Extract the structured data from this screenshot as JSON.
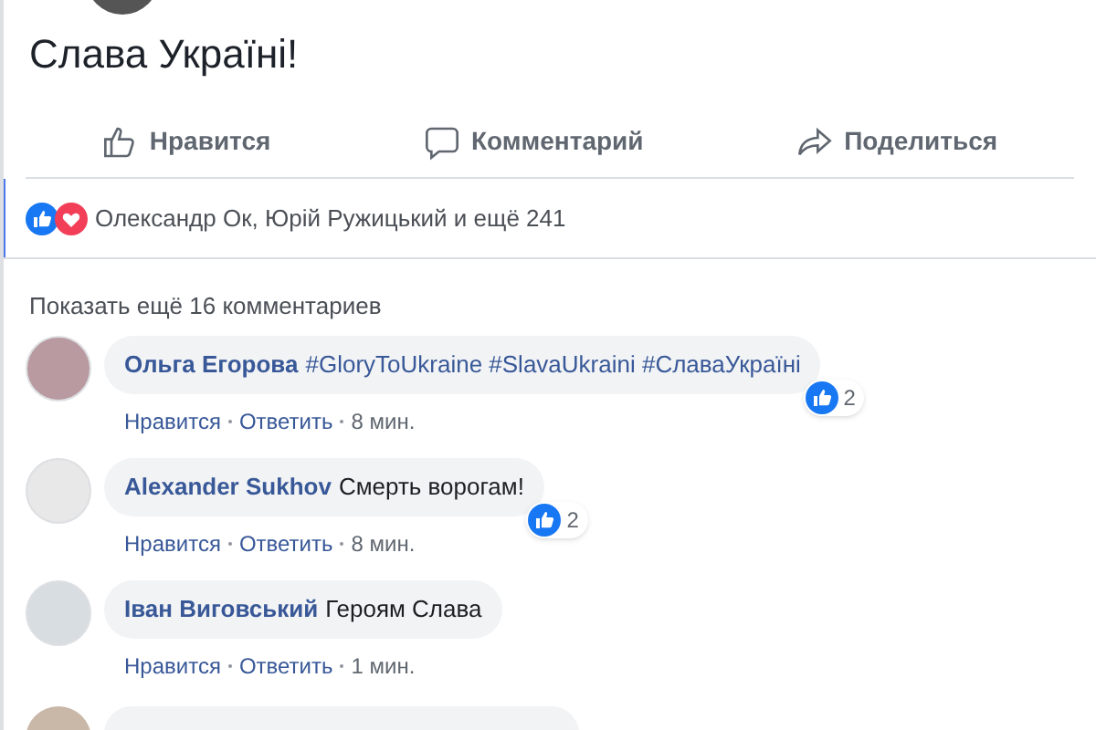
{
  "post": {
    "text": "Слава Україні!"
  },
  "actions": [
    {
      "kind": "like",
      "label": "Нравится"
    },
    {
      "kind": "comment",
      "label": "Комментарий"
    },
    {
      "kind": "share",
      "label": "Поделиться"
    }
  ],
  "reactions": {
    "icons": [
      {
        "kind": "like"
      },
      {
        "kind": "love"
      }
    ],
    "text": "Олександр Ок, Юрій Ружицький и ещё 241"
  },
  "more_comments": "Показать ещё 16 комментариев",
  "comments": [
    {
      "author": "Ольга Егорова",
      "kind": "hashtags",
      "text": "#GloryToUkraine #SlavaUkraini #СлаваУкраїні",
      "likes": "2",
      "actions": [
        "Нравится",
        "Ответить",
        "8 мин."
      ]
    },
    {
      "author": "Alexander Sukhov",
      "kind": "plain",
      "text": "Смерть ворогам!",
      "likes": "2",
      "actions": [
        "Нравится",
        "Ответить",
        "8 мин."
      ]
    },
    {
      "author": "Іван Виговський",
      "kind": "plain",
      "text": "Героям Слава",
      "actions": [
        "Нравится",
        "Ответить",
        "1 мин."
      ]
    }
  ]
}
